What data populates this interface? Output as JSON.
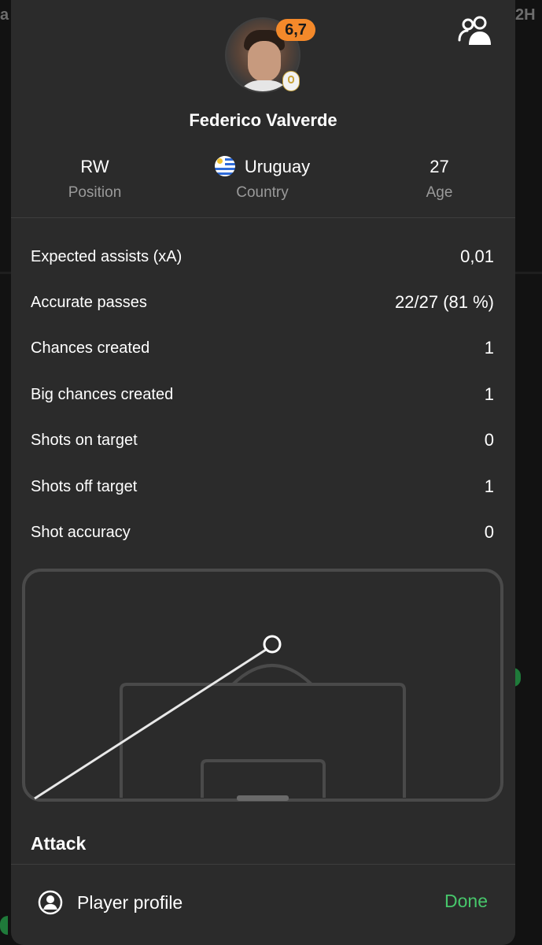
{
  "background": {
    "left_text": "a",
    "right_text": "2H"
  },
  "player": {
    "name": "Federico Valverde",
    "rating": "6,7",
    "position": {
      "value": "RW",
      "label": "Position"
    },
    "country": {
      "value": "Uruguay",
      "label": "Country",
      "flag": "uruguay-flag"
    },
    "age": {
      "value": "27",
      "label": "Age"
    }
  },
  "stats": [
    {
      "label": "Expected assists (xA)",
      "value": "0,01"
    },
    {
      "label": "Accurate passes",
      "value": "22/27 (81 %)"
    },
    {
      "label": "Chances created",
      "value": "1"
    },
    {
      "label": "Big chances created",
      "value": "1"
    },
    {
      "label": "Shots on target",
      "value": "0"
    },
    {
      "label": "Shots off target",
      "value": "1"
    },
    {
      "label": "Shot accuracy",
      "value": "0"
    }
  ],
  "section_title": "Attack",
  "footer": {
    "profile_label": "Player profile",
    "done_label": "Done"
  },
  "colors": {
    "accent_green": "#47c76b",
    "rating_badge": "#f4892a",
    "sheet_bg": "#2b2b2b"
  }
}
